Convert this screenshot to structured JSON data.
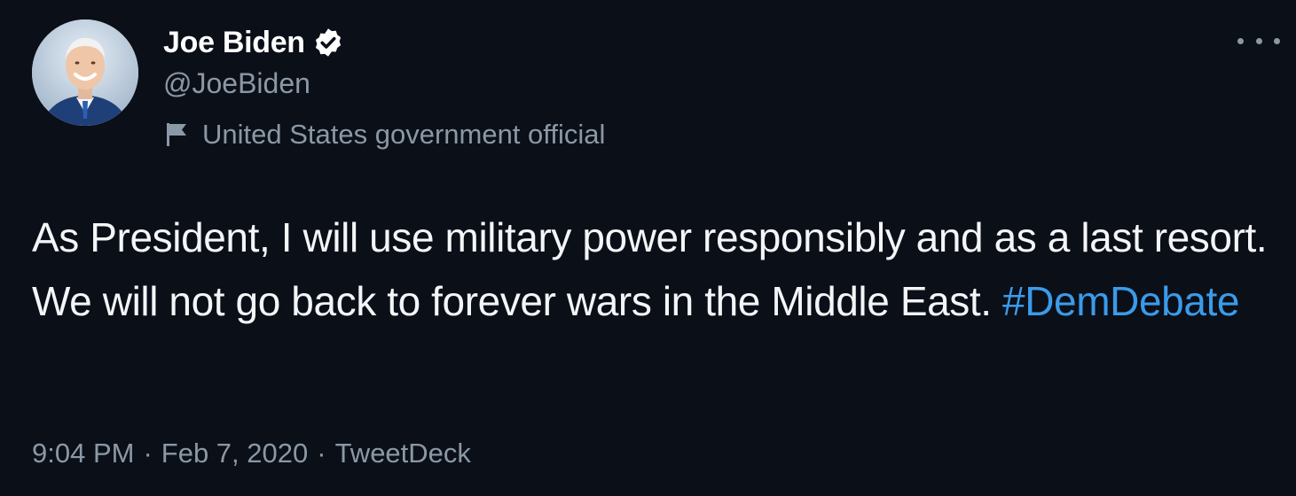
{
  "tweet": {
    "author": {
      "display_name": "Joe Biden",
      "handle": "@JoeBiden",
      "verified": true,
      "avatar_icon": "profile-photo",
      "label": "United States government official",
      "label_icon": "flag-icon"
    },
    "more_icon": "more-options-icon",
    "text_before_hashtag": "As President, I will use military power responsibly and as a last resort. We will not go back to forever wars in the Middle East. ",
    "hashtag": "#DemDebate",
    "time": "9:04 PM",
    "date": "Feb 7, 2020",
    "source": "TweetDeck",
    "separator": "·"
  },
  "colors": {
    "background": "#0b0f18",
    "text": "#f3f5f7",
    "muted": "#8b98a5",
    "link": "#3a9bea"
  }
}
